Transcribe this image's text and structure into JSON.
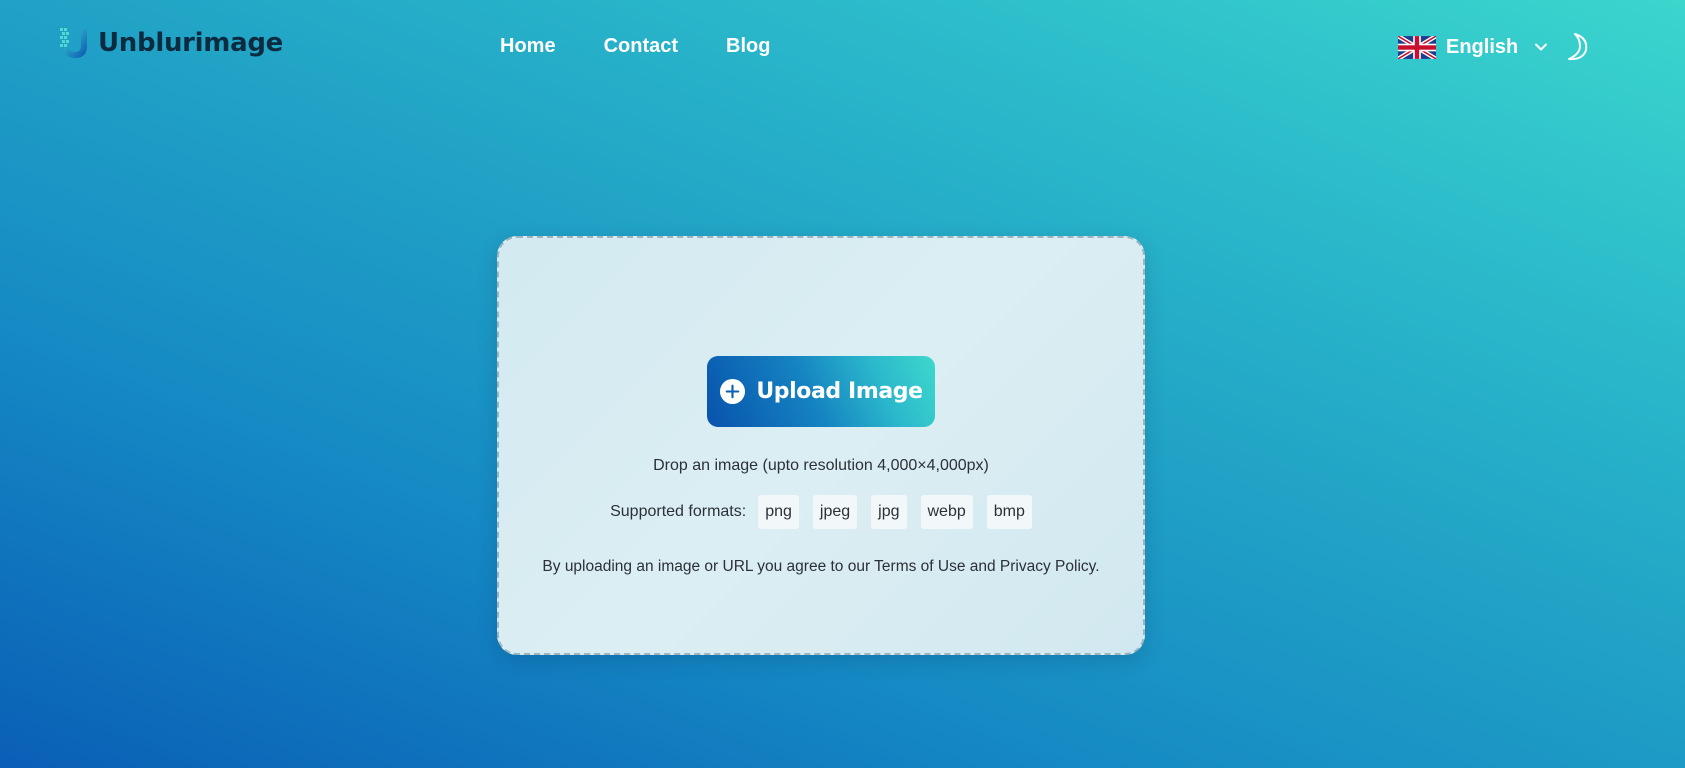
{
  "brand": {
    "name": "Unblurimage",
    "logo_icon": "u-pixel-logo-icon",
    "text_color": "#0b2b40"
  },
  "nav": {
    "items": [
      {
        "label": "Home"
      },
      {
        "label": "Contact"
      },
      {
        "label": "Blog"
      }
    ]
  },
  "language": {
    "selected": "English",
    "flag_icon": "uk-flag-icon",
    "dropdown_icon": "chevron-down-icon"
  },
  "theme_toggle": {
    "icon": "moon-icon"
  },
  "upload": {
    "button_label": "Upload Image",
    "button_icon": "plus-circle-icon",
    "drop_text": "Drop an image (upto resolution 4,000×4,000px)",
    "formats_label": "Supported formats:",
    "formats": [
      "png",
      "jpeg",
      "jpg",
      "webp",
      "bmp"
    ],
    "terms_text": "By uploading an image or URL you agree to our Terms of Use and Privacy Policy."
  },
  "colors": {
    "bg_start": "#0a5fb6",
    "bg_end": "#3bd6cc",
    "button_start": "#0852ac",
    "button_end": "#3dd8cc",
    "card_bg": "#d8ecf2",
    "text_dark": "#2b3137"
  }
}
